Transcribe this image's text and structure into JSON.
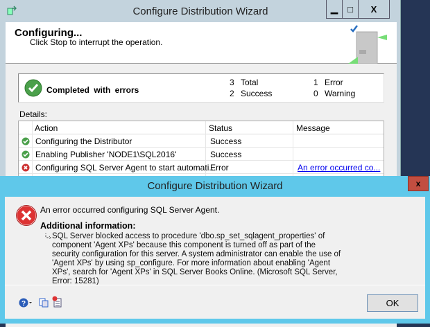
{
  "back_window": {
    "title": "Configure Distribution Wizard",
    "controls": {
      "minimize": "▁",
      "maximize": "□",
      "close": "X"
    },
    "header": {
      "title": "Configuring...",
      "subtitle": "Click Stop to interrupt the operation."
    },
    "summary": {
      "status": "Completed with errors",
      "total": "3",
      "total_label": "Total",
      "success": "2",
      "success_label": "Success",
      "error": "1",
      "error_label": "Error",
      "warning": "0",
      "warning_label": "Warning"
    },
    "details_label": "Details:",
    "table": {
      "columns": [
        "Action",
        "Status",
        "Message"
      ],
      "rows": [
        {
          "icon": "success",
          "action": "Configuring the Distributor",
          "status": "Success",
          "message": ""
        },
        {
          "icon": "success",
          "action": "Enabling Publisher 'NODE1\\SQL2016'",
          "status": "Success",
          "message": ""
        },
        {
          "icon": "error",
          "action": "Configuring SQL Server Agent to start automati...",
          "status": "Error",
          "message": "An error occurred co..."
        }
      ]
    }
  },
  "dialog": {
    "title": "Configure Distribution Wizard",
    "close": "x",
    "message": "An error occurred configuring SQL Server Agent.",
    "additional_label": "Additional information:",
    "detail": "SQL Server blocked access to procedure 'dbo.sp_set_sqlagent_properties' of component 'Agent XPs' because this component is turned off as part of the security configuration for this server. A system administrator can enable the use of 'Agent XPs' by using sp_configure. For more information about enabling 'Agent XPs', search for 'Agent XPs' in SQL Server Books Online. (Microsoft SQL Server, Error: 15281)",
    "ok_label": "OK"
  },
  "colors": {
    "dialog_border": "#5fc8ea",
    "close_red": "#c24e40",
    "link": "#0000ee",
    "desktop": "#253555"
  }
}
